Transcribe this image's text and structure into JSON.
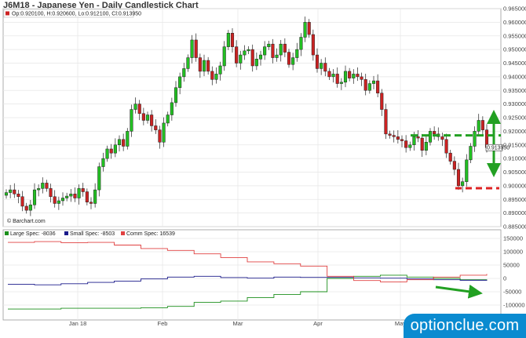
{
  "chart_data": [
    {
      "type": "candlestick",
      "title": "J6M18 - Japanese Yen - Daily Candlestick Chart",
      "ohlc_readout": "Op:0.920100, H:0.920600, Lo:0.912100, Cl:0.913950",
      "last_price_label": "0.913950",
      "source_label": "© Barchart.com",
      "ylim": [
        0.885,
        0.965
      ],
      "y_ticks": [
        "0.965000",
        "0.960000",
        "0.955000",
        "0.950000",
        "0.945000",
        "0.940000",
        "0.935000",
        "0.930000",
        "0.925000",
        "0.920000",
        "0.915000",
        "0.910000",
        "0.905000",
        "0.900000",
        "0.895000",
        "0.890000",
        "0.885000"
      ],
      "x_tick_labels": [
        "Jan 18",
        "Feb",
        "Mar",
        "Apr",
        "May"
      ],
      "grid": true,
      "close": [
        0.8975,
        0.8985,
        0.897,
        0.896,
        0.8925,
        0.891,
        0.893,
        0.8985,
        0.899,
        0.901,
        0.899,
        0.896,
        0.8935,
        0.8945,
        0.8955,
        0.8962,
        0.897,
        0.8955,
        0.899,
        0.8978,
        0.894,
        0.8935,
        0.8985,
        0.907,
        0.91,
        0.9135,
        0.912,
        0.915,
        0.917,
        0.9145,
        0.92,
        0.928,
        0.93,
        0.9265,
        0.924,
        0.926,
        0.922,
        0.9205,
        0.916,
        0.923,
        0.926,
        0.9305,
        0.936,
        0.94,
        0.943,
        0.947,
        0.9535,
        0.947,
        0.942,
        0.946,
        0.942,
        0.939,
        0.941,
        0.944,
        0.951,
        0.956,
        0.951,
        0.945,
        0.948,
        0.9495,
        0.95,
        0.944,
        0.9465,
        0.948,
        0.951,
        0.952,
        0.947,
        0.948,
        0.952,
        0.949,
        0.9445,
        0.947,
        0.95,
        0.9545,
        0.96,
        0.9555,
        0.948,
        0.943,
        0.945,
        0.942,
        0.94,
        0.941,
        0.9375,
        0.938,
        0.942,
        0.9395,
        0.941,
        0.94,
        0.939,
        0.935,
        0.9375,
        0.9385,
        0.934,
        0.928,
        0.919,
        0.9185,
        0.918,
        0.917,
        0.9165,
        0.914,
        0.915,
        0.918,
        0.9175,
        0.913,
        0.916,
        0.92,
        0.919,
        0.918,
        0.917,
        0.912,
        0.909,
        0.906,
        0.9,
        0.9015,
        0.9095,
        0.9145,
        0.92,
        0.924,
        0.9205,
        0.914
      ],
      "candle_color_rule": "green when close rises, red when close falls",
      "annotations": [
        {
          "kind": "dashed-line",
          "color": "#22a022",
          "y": 0.9185
        },
        {
          "kind": "dashed-line",
          "color": "#dd2222",
          "y": 0.8991
        },
        {
          "kind": "double-arrow",
          "color": "#22a022",
          "y_range": [
            0.904,
            0.927
          ]
        }
      ]
    },
    {
      "type": "line",
      "legend": [
        "Large Spec: -8036",
        "Small Spec: -8503",
        "Comm Spec: 16539"
      ],
      "ylim": [
        -150000,
        150000
      ],
      "y_ticks": [
        "150000",
        "100000",
        "50000",
        "0",
        "-50000",
        "-100000"
      ],
      "series": [
        {
          "name": "Large Spec",
          "color": "#1b8f1b",
          "values": [
            -115000,
            -115000,
            -112000,
            -112000,
            -112000,
            -110000,
            -105000,
            -90000,
            -85000,
            -72000,
            -60000,
            -50000,
            0,
            8000,
            12000,
            5000,
            0,
            -5000,
            -8036
          ]
        },
        {
          "name": "Small Spec",
          "color": "#1a1a8a",
          "values": [
            -22000,
            -24000,
            -20000,
            -15000,
            -10000,
            -2000,
            5000,
            8000,
            3000,
            1000,
            5000,
            4000,
            4000,
            2000,
            1000,
            -2000,
            -5000,
            -7000,
            -8503
          ]
        },
        {
          "name": "Comm Spec",
          "color": "#e04040",
          "values": [
            135000,
            138000,
            134000,
            135000,
            125000,
            112000,
            105000,
            92000,
            78000,
            62000,
            55000,
            46000,
            8000,
            -8000,
            -13000,
            -5000,
            5000,
            12000,
            16539
          ]
        }
      ],
      "annotations": [
        {
          "kind": "arrow",
          "color": "#22a022",
          "direction": "down-right"
        }
      ]
    }
  ],
  "watermark": "optionclue.com"
}
